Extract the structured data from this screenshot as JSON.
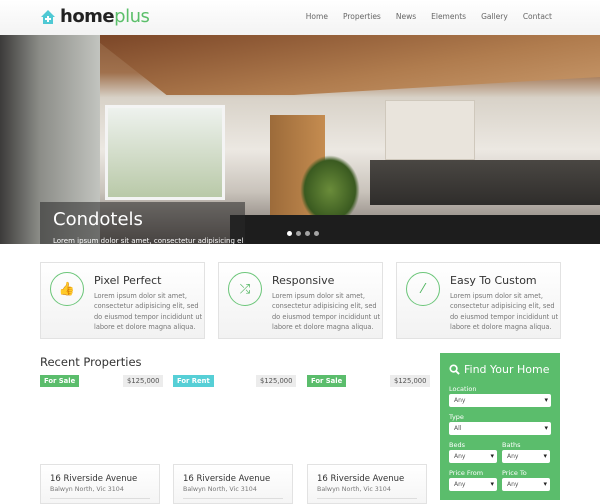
{
  "brand": {
    "name_a": "home",
    "name_b": "plus"
  },
  "nav": [
    "Home",
    "Properties",
    "News",
    "Elements",
    "Gallery",
    "Contact"
  ],
  "hero": {
    "title": "Condotels",
    "text": "Lorem ipsum dolor sit amet, consectetur adipisicing elit, sed",
    "slides": 4,
    "active_slide": 0
  },
  "features": [
    {
      "icon": "thumbs-up-icon",
      "title": "Pixel Perfect",
      "text": "Lorem ipsum dolor sit amet, consectetur adipisicing elit, sed do eiusmod tempor incididunt ut labore et dolore magna aliqua."
    },
    {
      "icon": "shuffle-icon",
      "title": "Responsive",
      "text": "Lorem ipsum dolor sit amet, consectetur adipisicing elit, sed do eiusmod tempor incididunt ut labore et dolore magna aliqua."
    },
    {
      "icon": "magic-wand-icon",
      "title": "Easy To Custom",
      "text": "Lorem ipsum dolor sit amet, consectetur adipisicing elit, sed do eiusmod tempor incididunt ut labore et dolore magna aliqua."
    }
  ],
  "recent": {
    "title": "Recent Properties",
    "items": [
      {
        "status": "For Sale",
        "status_color": "#5bbd6c",
        "price": "$125,000",
        "address": "16 Riverside Avenue",
        "suburb": "Balwyn North, Vic 3104"
      },
      {
        "status": "For Rent",
        "status_color": "#56cfd6",
        "price": "$125,000",
        "address": "16 Riverside Avenue",
        "suburb": "Balwyn North, Vic 3104"
      },
      {
        "status": "For Sale",
        "status_color": "#5bbd6c",
        "price": "$125,000",
        "address": "16 Riverside Avenue",
        "suburb": "Balwyn North, Vic 3104"
      }
    ]
  },
  "search": {
    "title": "Find Your Home",
    "fields": {
      "location": {
        "label": "Location",
        "value": "Any"
      },
      "type": {
        "label": "Type",
        "value": "All"
      },
      "beds": {
        "label": "Beds",
        "value": "Any"
      },
      "baths": {
        "label": "Baths",
        "value": "Any"
      },
      "price_from": {
        "label": "Price From",
        "value": "Any"
      },
      "price_to": {
        "label": "Price To",
        "value": "Any"
      }
    }
  },
  "colors": {
    "accent": "#5bbd6c",
    "rent": "#56cfd6",
    "logo_icon": "#4fc9d4"
  }
}
